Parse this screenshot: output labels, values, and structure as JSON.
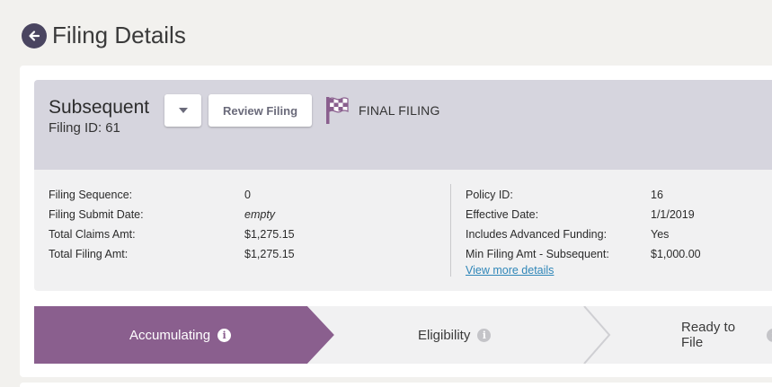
{
  "header": {
    "title": "Filing Details",
    "back_icon": "arrow-left-icon"
  },
  "filing": {
    "type": "Subsequent",
    "id_label": "Filing ID:",
    "id_value": "61",
    "review_label": "Review Filing",
    "final_label": "FINAL FILING",
    "final_icon": "checkered-flag-icon",
    "dropdown_icon": "caret-down-icon"
  },
  "details": {
    "left": [
      {
        "label": "Filing Sequence:",
        "value": "0"
      },
      {
        "label": "Filing Submit Date:",
        "value": "empty"
      },
      {
        "label": "Total Claims Amt:",
        "value": "$1,275.15"
      },
      {
        "label": "Total Filing Amt:",
        "value": "$1,275.15"
      }
    ],
    "right": [
      {
        "label": "Policy ID:",
        "value": "16"
      },
      {
        "label": "Effective Date:",
        "value": "1/1/2019"
      },
      {
        "label": "Includes Advanced Funding:",
        "value": "Yes"
      },
      {
        "label": "Min Filing Amt - Subsequent:",
        "value": "$1,000.00"
      }
    ],
    "more_link": "View more details"
  },
  "steps": [
    {
      "label": "Accumulating",
      "active": true
    },
    {
      "label": "Eligibility",
      "active": false
    },
    {
      "label": "Ready to File",
      "active": false
    }
  ],
  "colors": {
    "accent": "#8a5f8e",
    "header_band": "#d6d5de",
    "link": "#2f86b8",
    "back_button": "#4a4560"
  }
}
